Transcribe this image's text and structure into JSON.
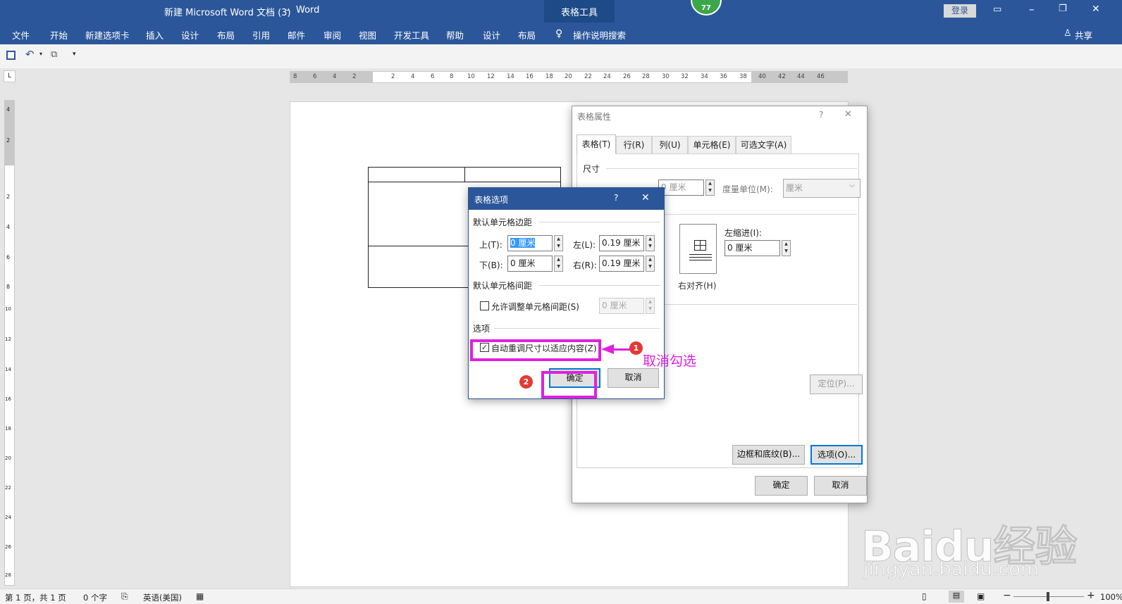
{
  "title": {
    "doc": "新建 Microsoft Word 文档 (3)",
    "sep": "-",
    "app": "Word",
    "context": "表格工具",
    "login": "登录",
    "badge": "77"
  },
  "ribbon_tabs": [
    "文件",
    "开始",
    "新建选项卡",
    "插入",
    "设计",
    "布局",
    "引用",
    "邮件",
    "审阅",
    "视图",
    "开发工具",
    "帮助",
    "设计",
    "布局"
  ],
  "tell_me": "操作说明搜索",
  "share": "共享",
  "ruler_h": [
    "8",
    "6",
    "4",
    "2",
    "2",
    "4",
    "6",
    "8",
    "10",
    "12",
    "14",
    "16",
    "18",
    "20",
    "22",
    "24",
    "26",
    "28",
    "30",
    "32",
    "34",
    "36",
    "38",
    "40",
    "42",
    "44",
    "46"
  ],
  "ruler_v": [
    "4",
    "2",
    "2",
    "4",
    "6",
    "8",
    "10",
    "12",
    "14",
    "16",
    "18",
    "20",
    "22",
    "24",
    "26",
    "28"
  ],
  "table_props": {
    "title": "表格属性",
    "help": "?",
    "close": "✕",
    "tabs": [
      "表格(T)",
      "行(R)",
      "列(U)",
      "单元格(E)",
      "可选文字(A)"
    ],
    "size_group": "尺寸",
    "width_value": "0 厘米",
    "unit_label": "度量单位(M):",
    "unit_value": "厘米",
    "indent_label": "左缩进(I):",
    "indent_value": "0 厘米",
    "align_right": "右对齐(H)",
    "position_btn": "定位(P)...",
    "borders_btn": "边框和底纹(B)...",
    "options_btn": "选项(O)...",
    "ok": "确定",
    "cancel": "取消"
  },
  "table_options": {
    "title": "表格选项",
    "help": "?",
    "close": "✕",
    "margins_group": "默认单元格边距",
    "top_label": "上(T):",
    "top_value": "0 厘米",
    "left_label": "左(L):",
    "left_value": "0.19 厘米",
    "bottom_label": "下(B):",
    "bottom_value": "0 厘米",
    "right_label": "右(R):",
    "right_value": "0.19 厘米",
    "spacing_group": "默认单元格间距",
    "allow_spacing": "允许调整单元格间距(S)",
    "spacing_value": "0 厘米",
    "options_group": "选项",
    "autofit": "自动重调尺寸以适应内容(Z)",
    "autofit_checked": true,
    "ok": "确定",
    "cancel": "取消"
  },
  "annotations": {
    "step1": "1",
    "step2": "2",
    "note": "取消勾选",
    "color": "#e020e0"
  },
  "status": {
    "page": "第 1 页，共 1 页",
    "words": "0 个字",
    "lang": "英语(美国)",
    "zoom": "100%"
  },
  "watermark": {
    "brand": "Baidu经验",
    "url": "jingyan.baidu.com"
  }
}
